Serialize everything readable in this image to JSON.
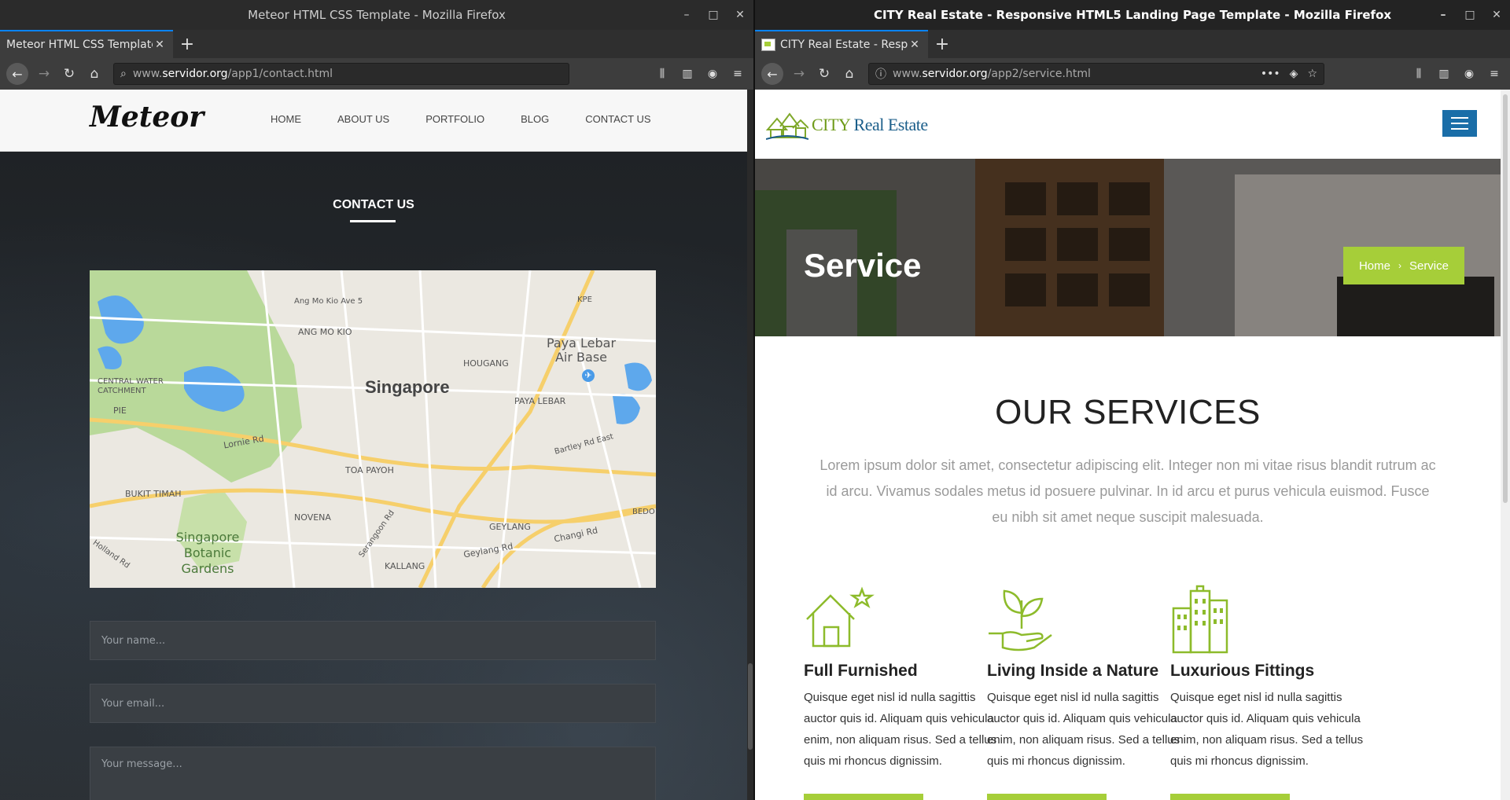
{
  "left_window": {
    "title": "Meteor HTML CSS Template - Mozilla Firefox",
    "tab_title": "Meteor HTML CSS Template",
    "url_prefix": "www.",
    "url_host": "servidor.org",
    "url_path": "/app1/contact.html",
    "site": {
      "logo": "Meteor",
      "menu": [
        "HOME",
        "ABOUT US",
        "PORTFOLIO",
        "BLOG",
        "CONTACT US"
      ],
      "section_title": "CONTACT US",
      "map": {
        "city": "Singapore",
        "labels": [
          "Ang Mo Kio Ave 5",
          "ANG MO KIO",
          "Paya Lebar Air Base",
          "HOUGANG",
          "KPE",
          "CENTRAL WATER CATCHMENT",
          "PIE",
          "PAYA LEBAR",
          "Lornie Rd",
          "TOA PAYOH",
          "Bartley Rd East",
          "BUKIT TIMAH",
          "NOVENA",
          "GEYLANG",
          "Singapore Botanic Gardens",
          "Serangoon Rd",
          "Geylang Rd",
          "Changi Rd",
          "KALLANG",
          "BEDO",
          "Holland Rd"
        ]
      },
      "form": {
        "name_placeholder": "Your name...",
        "email_placeholder": "Your email...",
        "message_placeholder": "Your message..."
      }
    }
  },
  "right_window": {
    "title": "CITY Real Estate - Responsive HTML5 Landing Page Template - Mozilla Firefox",
    "tab_title": "CITY Real Estate - Respo",
    "url_prefix": "www.",
    "url_host": "servidor.org",
    "url_path": "/app2/service.html",
    "site": {
      "logo_city": "CITY",
      "logo_rest": " Real Estate",
      "hero_title": "Service",
      "breadcrumb_home": "Home",
      "breadcrumb_sep": "›",
      "breadcrumb_current": "Service",
      "section_title": "OUR SERVICES",
      "section_text": "Lorem ipsum dolor sit amet, consectetur adipiscing elit. Integer non mi vitae risus blandit rutrum ac id arcu. Vivamus sodales metus id posuere pulvinar. In id arcu et purus vehicula euismod. Fusce eu nibh sit amet neque suscipit malesuada.",
      "services": [
        {
          "icon": "house-star-icon",
          "title": "Full Furnished",
          "text": "Quisque eget nisl id nulla sagittis auctor quis id. Aliquam quis vehicula enim, non aliquam risus. Sed a tellus quis mi rhoncus dignissim."
        },
        {
          "icon": "plant-hand-icon",
          "title": "Living Inside a Nature",
          "text": "Quisque eget nisl id nulla sagittis auctor quis id. Aliquam quis vehicula enim, non aliquam risus. Sed a tellus quis mi rhoncus dignissim."
        },
        {
          "icon": "buildings-icon",
          "title": "Luxurious Fittings",
          "text": "Quisque eget nisl id nulla sagittis auctor quis id. Aliquam quis vehicula enim, non aliquam risus. Sed a tellus quis mi rhoncus dignissim."
        }
      ]
    }
  },
  "colors": {
    "accent_green": "#a6ce39",
    "accent_blue": "#1a6ea8",
    "firefox_blue": "#0a84ff"
  }
}
